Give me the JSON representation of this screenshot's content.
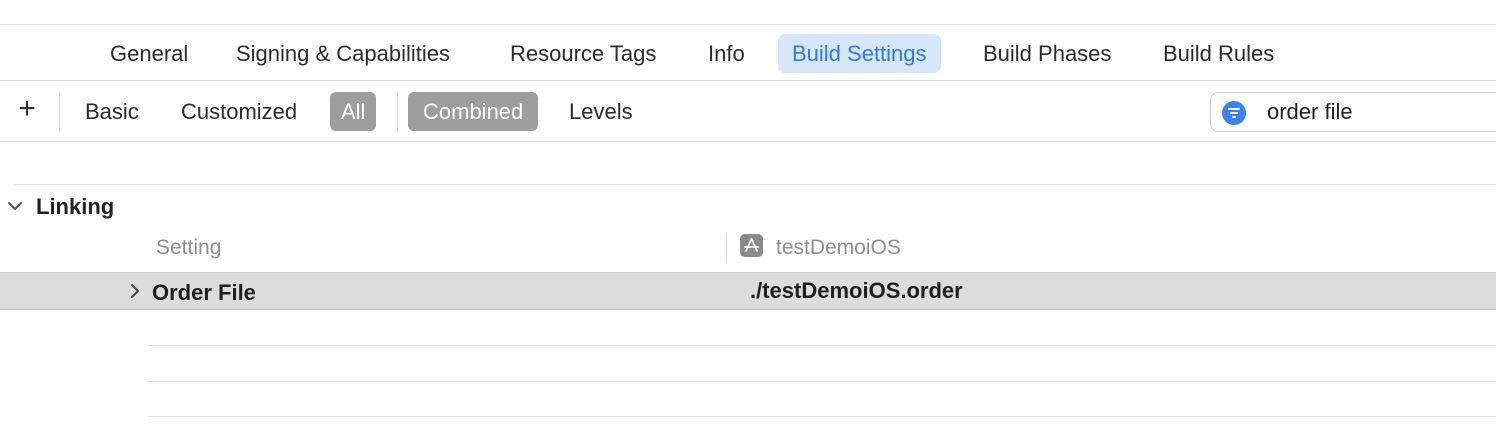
{
  "tabs": [
    {
      "label": "General",
      "active": false
    },
    {
      "label": "Signing & Capabilities",
      "active": false
    },
    {
      "label": "Resource Tags",
      "active": false
    },
    {
      "label": "Info",
      "active": false
    },
    {
      "label": "Build Settings",
      "active": true
    },
    {
      "label": "Build Phases",
      "active": false
    },
    {
      "label": "Build Rules",
      "active": false
    }
  ],
  "toolbar": {
    "add_icon": "plus-icon",
    "add_label": "+",
    "scope": {
      "basic": "Basic",
      "customized": "Customized",
      "all": "All",
      "selected": "All"
    },
    "view": {
      "combined": "Combined",
      "levels": "Levels",
      "selected": "Combined"
    },
    "search": {
      "icon": "filter-icon",
      "value": "order file"
    }
  },
  "section": {
    "title": "Linking",
    "expanded": true,
    "columns": {
      "setting": "Setting",
      "target": "testDemoiOS",
      "target_icon": "app-target-icon"
    },
    "rows": [
      {
        "name": "Order File",
        "value": "./testDemoiOS.order",
        "expanded": false
      }
    ]
  },
  "colors": {
    "accent": "#2f7be0",
    "active_tab_bg": "#d7e6f8",
    "segment_selected_bg": "#9e9e9e",
    "row_bg": "#dcdcdc",
    "filter_icon": "#3b82f0"
  }
}
